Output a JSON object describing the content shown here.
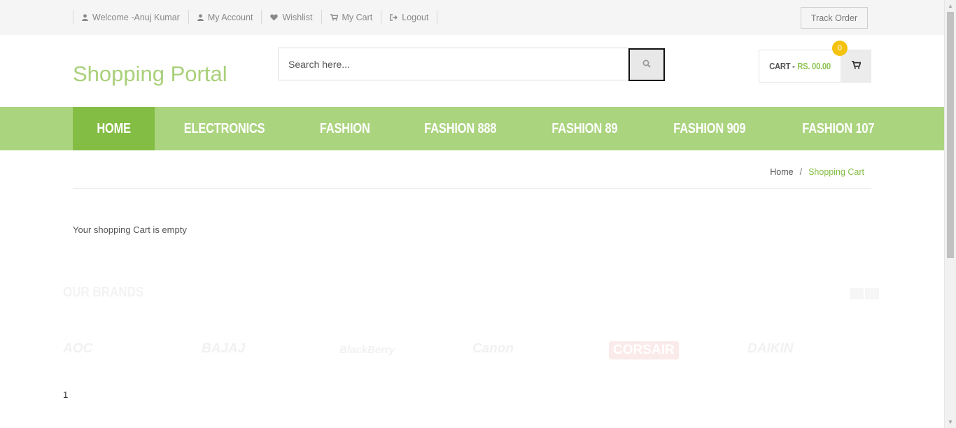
{
  "topbar": {
    "links": [
      {
        "label": "Welcome -Anuj Kumar",
        "icon": "user-icon"
      },
      {
        "label": "My Account",
        "icon": "user-icon"
      },
      {
        "label": "Wishlist",
        "icon": "heart-icon"
      },
      {
        "label": "My Cart",
        "icon": "cart-icon"
      },
      {
        "label": "Logout",
        "icon": "sign-out-icon"
      }
    ],
    "track_order": "Track Order"
  },
  "header": {
    "logo": "Shopping Portal",
    "search": {
      "placeholder": "Search here...",
      "value": ""
    },
    "cart": {
      "label": "CART -",
      "amount": "RS. 00.00",
      "count": "0"
    }
  },
  "nav": {
    "items": [
      "HOME",
      "ELECTRONICS",
      "FASHION",
      "FASHION 888",
      "FASHION 89",
      "FASHION 909",
      "FASHION 107"
    ],
    "active": "HOME"
  },
  "breadcrumb": {
    "home": "Home",
    "separator": "/",
    "current": "Shopping Cart"
  },
  "main": {
    "empty_message": "Your shopping Cart is empty"
  },
  "brands": {
    "title": "OUR BRANDS",
    "items": [
      "AOC",
      "BAJAJ",
      "BlackBerry",
      "Canon",
      "CORSAIR",
      "DAIKIN"
    ]
  },
  "footer": {
    "page_number": "1"
  },
  "colors": {
    "accent": "#84bd44",
    "nav_bg": "#abd47f",
    "logo": "#a9d07a",
    "badge": "#f4c20d"
  }
}
